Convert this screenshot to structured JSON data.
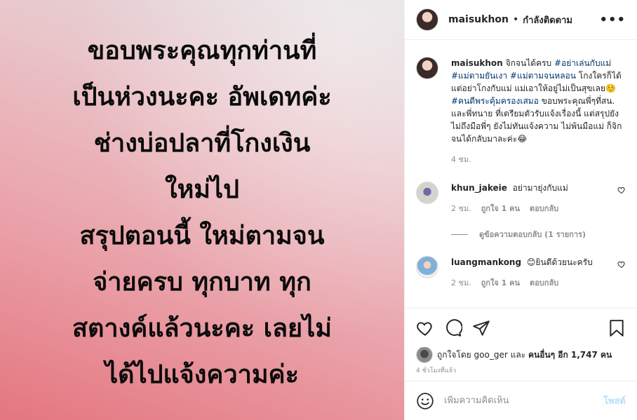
{
  "image_text": {
    "lines": [
      "ขอบพระคุณทุกท่านที่",
      "เป็นห่วงนะคะ อัพเดทค่ะ",
      "ช่างบ่อปลาที่โกงเงิน",
      "ใหม่ไป",
      "สรุปตอนนี้ ใหม่ตามจน",
      "จ่ายครบ ทุกบาท ทุก",
      "สตางค์แล้วนะคะ เลยไม่",
      "ได้ไปแจ้งความค่ะ"
    ]
  },
  "header": {
    "username": "maisukhon",
    "dot": "•",
    "follow_status": "กำลังติดตาม",
    "more": "•••"
  },
  "caption": {
    "username": "maisukhon",
    "segments": [
      {
        "text": "จิกจนได้ครบ ",
        "tag": false
      },
      {
        "text": "#อย่าเล่นกับแม่",
        "tag": true
      },
      {
        "text": " ",
        "tag": false
      },
      {
        "text": "#แม่ตามยันเงา",
        "tag": true
      },
      {
        "text": " ",
        "tag": false
      },
      {
        "text": "#แม่ตามจนหลอน",
        "tag": true
      },
      {
        "text": " โกงใครก็ได้ แต่อย่าโกงกับแม่ แม่เอาให้อยู่ไม่เป็นสุขเลย☺️ ",
        "tag": false
      },
      {
        "text": "#คนดีพระคุ้มครองเสมอ",
        "tag": true
      },
      {
        "text": " ขอบพระคุณพี่ๆที่สน. และพี่ทนาย ที่เตรียมตัวรับแจ้งเรื่องนี้ แต่สรุปยังไม่ถึงมือพี่ๆ ยังไม่ทันแจ้งความ ไม่พ้นมือแม่ ก็จิกจนได้กลับมาละค่ะ😂",
        "tag": false
      }
    ],
    "time": "4 ชม."
  },
  "comments": [
    {
      "username": "khun_jakeie",
      "text": "อย่ามายุ่งกับแม่",
      "time": "2 ชม.",
      "likes": "ถูกใจ 1 คน",
      "reply": "ตอบกลับ",
      "view_replies": "ดูข้อความตอบกลับ (1 รายการ)"
    },
    {
      "username": "luangmankong",
      "text": "😊ยินดีด้วยนะครับ",
      "time": "2 ชม.",
      "likes": "ถูกใจ 1 คน",
      "reply": "ตอบกลับ"
    }
  ],
  "likes": {
    "prefix": "ถูกใจโดย",
    "user": "goo_ger",
    "and": "และ",
    "others": "คนอื่นๆ อีก 1,747 คน"
  },
  "timeago": "4 ชั่วโมงที่แล้ว",
  "add_comment": {
    "placeholder": "เพิ่มความคิดเห็น",
    "post_label": "โพสต์"
  }
}
